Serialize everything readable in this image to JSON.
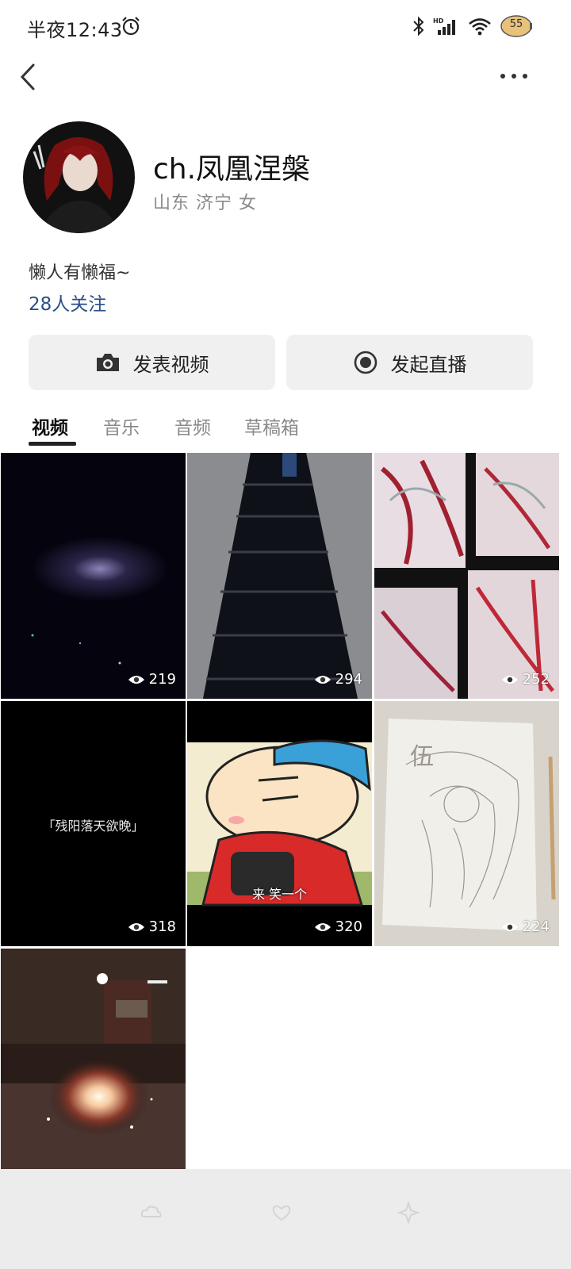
{
  "status": {
    "time": "半夜12:43",
    "battery": "55",
    "icons": [
      "alarm-icon",
      "bluetooth-icon",
      "hd-signal-icon",
      "wifi-icon",
      "battery-icon"
    ]
  },
  "nav": {
    "back_icon": "chevron-left-icon",
    "more_icon": "more-dots-icon"
  },
  "profile": {
    "name": "ch.凤凰涅槃",
    "location": "山东 济宁 女",
    "bio": "懒人有懒福~",
    "followers": "28人关注"
  },
  "actions": {
    "post_video": "发表视频",
    "start_live": "发起直播"
  },
  "tabs": [
    {
      "label": "视频",
      "active": true
    },
    {
      "label": "音乐",
      "active": false
    },
    {
      "label": "音频",
      "active": false
    },
    {
      "label": "草稿箱",
      "active": false
    }
  ],
  "videos": [
    {
      "views": "219"
    },
    {
      "views": "294"
    },
    {
      "views": "252"
    },
    {
      "views": "318",
      "caption": "「残阳落天欲晚」"
    },
    {
      "views": "320",
      "caption": "来 笑一个"
    },
    {
      "views": "224"
    },
    {
      "views": ""
    }
  ],
  "colors": {
    "link": "#2a4f86",
    "button_bg": "#f0f0f0",
    "bottom_bar": "#ececec"
  }
}
